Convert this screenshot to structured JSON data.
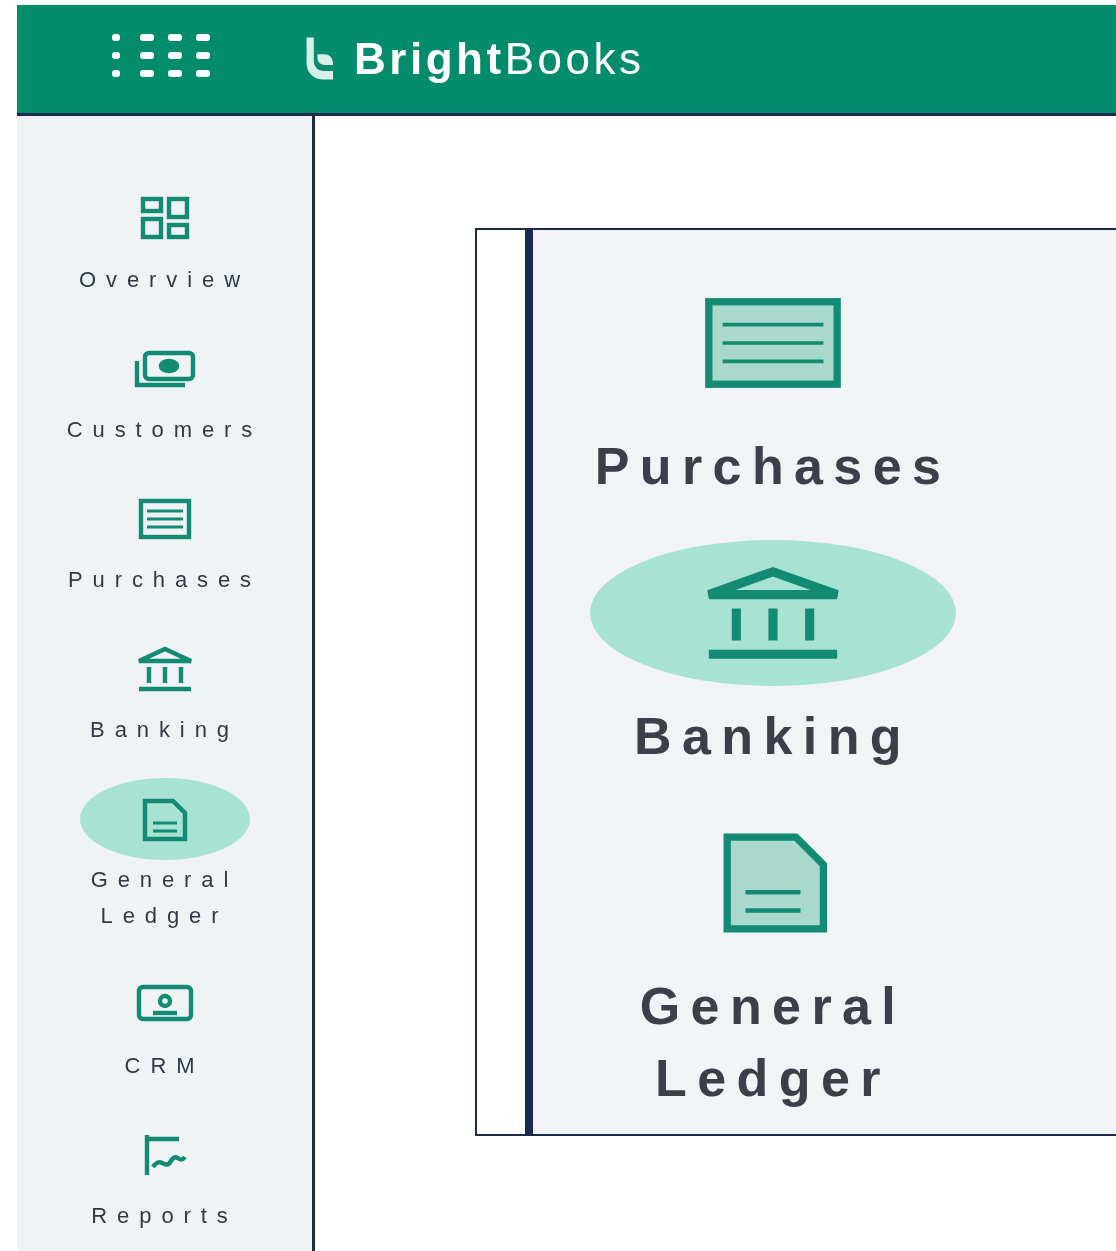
{
  "header": {
    "logo": "**Bright**Books"
  },
  "sidebar": {
    "items": [
      {
        "label": "Overview",
        "kind": "dashboard",
        "selected": false
      },
      {
        "label": "Customers",
        "kind": "card",
        "selected": false
      },
      {
        "label": "Purchases",
        "kind": "list",
        "selected": false
      },
      {
        "label": "Banking",
        "kind": "bank",
        "selected": false
      },
      {
        "label": "General Ledger",
        "kind": "document",
        "selected": true
      },
      {
        "label": "CRM",
        "kind": "monitor",
        "selected": false
      },
      {
        "label": "Reports",
        "kind": "chart",
        "selected": false
      }
    ]
  },
  "panel": {
    "items": [
      {
        "label": "Purchases",
        "kind": "list",
        "selected": false
      },
      {
        "label": "Banking",
        "kind": "bank",
        "selected": true
      },
      {
        "label": "General Ledger",
        "kind": "document",
        "selected": false
      }
    ]
  }
}
